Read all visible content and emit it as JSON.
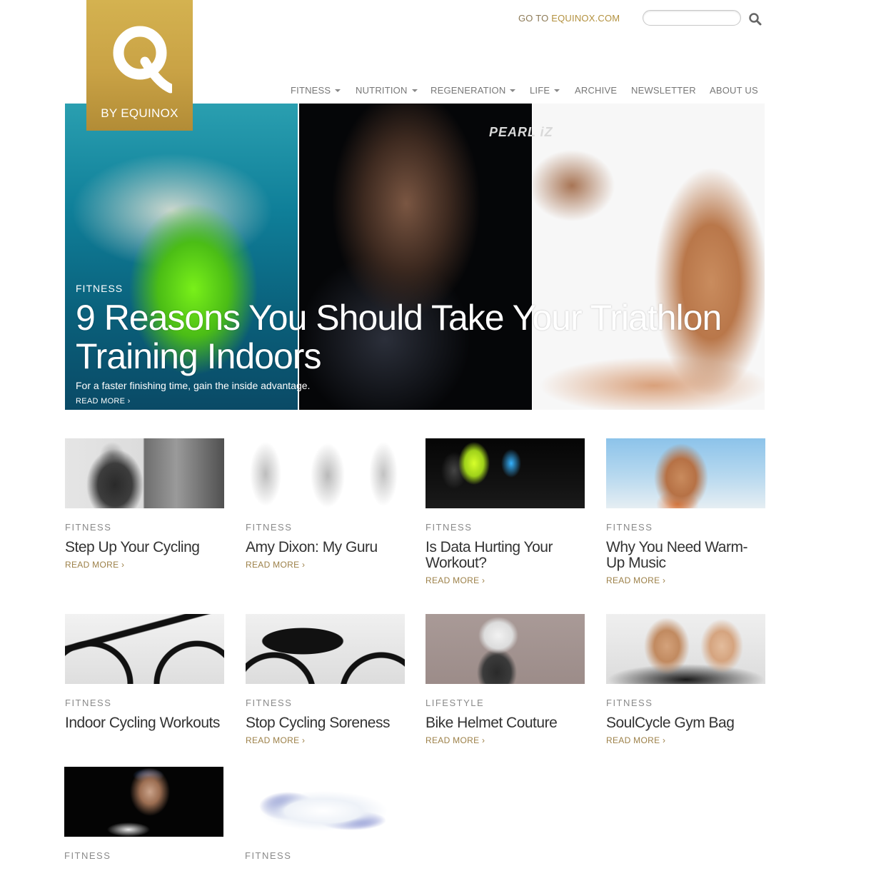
{
  "header": {
    "logo_text": "BY EQUINOX",
    "goto_prefix": "GO TO ",
    "goto_link": "EQUINOX.COM",
    "search_placeholder": ""
  },
  "nav": {
    "items": [
      {
        "label": "FITNESS",
        "dropdown": true
      },
      {
        "label": "NUTRITION",
        "dropdown": true
      },
      {
        "label": "REGENERATION",
        "dropdown": true
      },
      {
        "label": "LIFE",
        "dropdown": true
      },
      {
        "label": "ARCHIVE",
        "dropdown": false
      },
      {
        "label": "NEWSLETTER",
        "dropdown": false
      },
      {
        "label": "ABOUT US",
        "dropdown": false
      }
    ]
  },
  "hero": {
    "category": "FITNESS",
    "title": "9 Reasons You Should Take Your Triathlon Training Indoors",
    "subtitle": "For a faster finishing time, gain the inside advantage.",
    "read_more": "READ MORE ›",
    "bike_brand": "PEARL iZ"
  },
  "articles": [
    {
      "category": "FITNESS",
      "title": "Step Up Your Cycling",
      "read_more": "READ MORE ›"
    },
    {
      "category": "FITNESS",
      "title": "Amy Dixon: My Guru",
      "read_more": "READ MORE ›"
    },
    {
      "category": "FITNESS",
      "title": "Is Data Hurting Your Workout?",
      "read_more": "READ MORE ›"
    },
    {
      "category": "FITNESS",
      "title": "Why You Need Warm-Up Music",
      "read_more": "READ MORE ›"
    },
    {
      "category": "FITNESS",
      "title": "Indoor Cycling Workouts",
      "read_more": ""
    },
    {
      "category": "FITNESS",
      "title": "Stop Cycling Soreness",
      "read_more": "READ MORE ›"
    },
    {
      "category": "LIFESTYLE",
      "title": "Bike Helmet Couture",
      "read_more": "READ MORE ›"
    },
    {
      "category": "FITNESS",
      "title": "SoulCycle Gym Bag",
      "read_more": "READ MORE ›"
    },
    {
      "category": "FITNESS"
    },
    {
      "category": "FITNESS"
    }
  ],
  "colors": {
    "gold": "#c9a245",
    "link_gold": "#9c8048",
    "nav_gray": "#777777"
  }
}
